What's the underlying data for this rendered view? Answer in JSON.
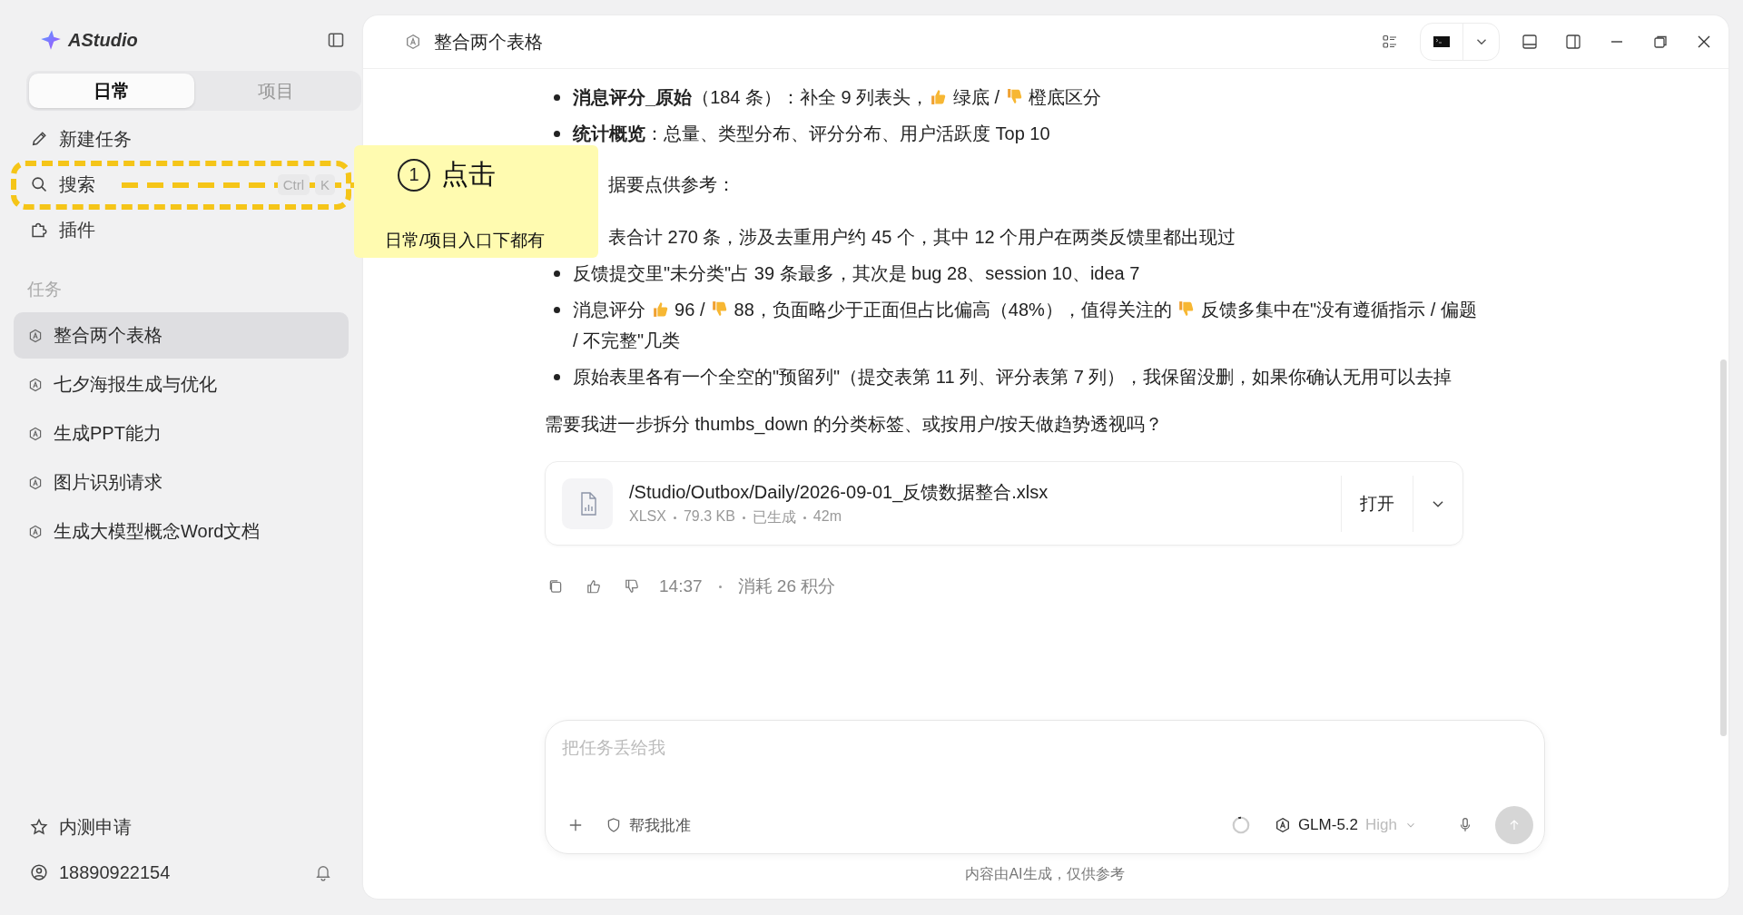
{
  "app": {
    "name": "AStudio"
  },
  "sidebar": {
    "tabs": [
      {
        "label": "日常",
        "selected": true
      },
      {
        "label": "项目",
        "selected": false
      }
    ],
    "actions": [
      {
        "kind": "new",
        "label": "新建任务"
      },
      {
        "kind": "search",
        "label": "搜索",
        "keys": [
          "Ctrl",
          "K"
        ]
      },
      {
        "kind": "plugin",
        "label": "插件"
      }
    ],
    "section_title": "任务",
    "tasks": [
      {
        "label": "整合两个表格",
        "selected": true
      },
      {
        "label": "七夕海报生成与优化",
        "selected": false
      },
      {
        "label": "生成PPT能力",
        "selected": false
      },
      {
        "label": "图片识别请求",
        "selected": false
      },
      {
        "label": "生成大模型概念Word文档",
        "selected": false
      }
    ],
    "beta": "内测申请",
    "account": "18890922154"
  },
  "annotation": {
    "step": "1",
    "title": "点击",
    "note": "日常/项目入口下都有"
  },
  "chat": {
    "title": "整合两个表格",
    "lines": [
      {
        "kind": "bullet",
        "parts": [
          {
            "kind": "text",
            "text": "**消息评分_原始**（184 条）：补全 9 列表头，"
          },
          {
            "kind": "up"
          },
          {
            "kind": "text",
            "text": " 绿底 / "
          },
          {
            "kind": "down"
          },
          {
            "kind": "text",
            "text": " 橙底区分"
          }
        ]
      },
      {
        "kind": "bullet",
        "parts": [
          {
            "kind": "text",
            "text": "**统计概览**：总量、类型分布、评分分布、用户活跃度 Top 10"
          }
        ]
      },
      {
        "kind": "cut-para",
        "parts": [
          {
            "kind": "text",
            "text": "据要点供参考："
          }
        ]
      },
      {
        "kind": "cut",
        "parts": [
          {
            "kind": "text",
            "text": "表合计 270 条，涉及去重用户约 45 个，其中 12 个用户在两类反馈里都出现过"
          }
        ]
      },
      {
        "kind": "bullet",
        "parts": [
          {
            "kind": "text",
            "text": "反馈提交里\"未分类\"占 39 条最多，其次是 bug 28、session 10、idea 7"
          }
        ]
      },
      {
        "kind": "bullet",
        "parts": [
          {
            "kind": "text",
            "text": "消息评分 "
          },
          {
            "kind": "up"
          },
          {
            "kind": "text",
            "text": " 96 / "
          },
          {
            "kind": "down"
          },
          {
            "kind": "text",
            "text": " 88，负面略少于正面但占比偏高（48%），值得关注的 "
          },
          {
            "kind": "down"
          },
          {
            "kind": "text",
            "text": " 反馈多集中在\"没有遵循指示 / 偏题"
          },
          {
            "kind": "break"
          },
          {
            "kind": "text",
            "text": "/ 不完整\"几类"
          }
        ]
      },
      {
        "kind": "bullet",
        "parts": [
          {
            "kind": "text",
            "text": "原始表里各有一个全空的\"预留列\"（提交表第 11 列、评分表第 7 列），我保留没删，如果你确认无用可以去掉"
          }
        ]
      },
      {
        "kind": "para",
        "parts": [
          {
            "kind": "text",
            "text": "需要我进一步拆分 thumbs_down 的分类标签、或按用户/按天做趋势透视吗？"
          }
        ]
      }
    ],
    "file": {
      "path": "/Studio/Outbox/Daily/2026-09-01_反馈数据整合.xlsx",
      "meta": [
        "XLSX",
        "79.3 KB",
        "已生成",
        "42m"
      ],
      "open": "打开"
    },
    "meta": {
      "time": "14:37",
      "cost": "消耗 26 积分"
    }
  },
  "composer": {
    "placeholder": "把任务丢给我",
    "approve": "帮我批准",
    "model": "GLM-5.2",
    "effort": "High"
  },
  "disclaimer": "内容由AI生成，仅供参考"
}
